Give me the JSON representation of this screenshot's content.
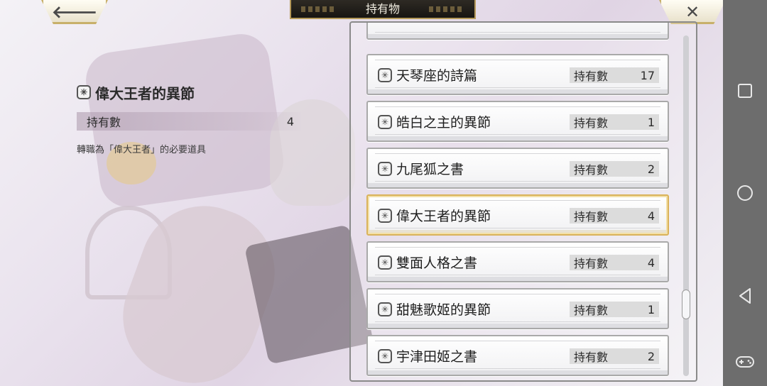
{
  "header": {
    "title": "持有物",
    "back_glyph": "🡐",
    "close_glyph": "✕"
  },
  "detail": {
    "name": "偉大王者的異節",
    "owned_label": "持有數",
    "owned_value": "4",
    "description": "轉職為「偉大王者」的必要道具"
  },
  "list": {
    "items": [
      {
        "name": "天琴座的詩篇",
        "count_label": "持有數",
        "count": "17"
      },
      {
        "name": "皓白之主的異節",
        "count_label": "持有數",
        "count": "1"
      },
      {
        "name": "九尾狐之書",
        "count_label": "持有數",
        "count": "2"
      },
      {
        "name": "偉大王者的異節",
        "count_label": "持有數",
        "count": "4"
      },
      {
        "name": "雙面人格之書",
        "count_label": "持有數",
        "count": "4"
      },
      {
        "name": "甜魅歌姬的異節",
        "count_label": "持有數",
        "count": "1"
      },
      {
        "name": "宇津田姬之書",
        "count_label": "持有數",
        "count": "2"
      }
    ],
    "selected_index": 3,
    "icon": "book-icon",
    "icon_glyph": "✳"
  },
  "colors": {
    "selected_border": "#d9b25a",
    "title_tab_bg": "#1c1a16",
    "navbar_bg": "#6d6d6d"
  },
  "system_nav": {
    "buttons": [
      "recents-icon",
      "home-icon",
      "back-icon",
      "gamepad-icon"
    ]
  }
}
